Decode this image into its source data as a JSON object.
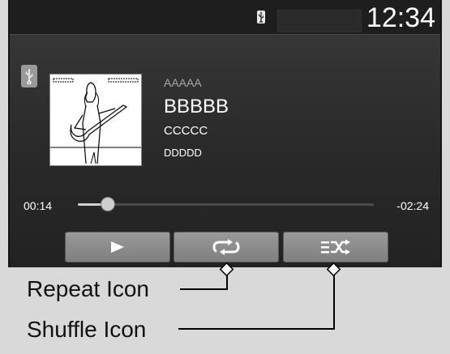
{
  "status": {
    "time": "12:34",
    "usb_icon": "usb-icon"
  },
  "source": {
    "icon": "usb-icon"
  },
  "track": {
    "artist": "AAAAA",
    "title": "BBBBB",
    "album": "CCCCC",
    "extra": "DDDDD",
    "elapsed": "00:14",
    "remaining": "-02:24",
    "progress": 0.1
  },
  "controls": {
    "play_icon": "play-icon",
    "repeat_icon": "repeat-icon",
    "shuffle_icon": "shuffle-icon"
  },
  "callouts": {
    "repeat": "Repeat Icon",
    "shuffle": "Shuffle Icon"
  },
  "colors": {
    "background": "#d9d9d9",
    "screen": "#2a2a2a",
    "button": "#8a8a8a"
  }
}
